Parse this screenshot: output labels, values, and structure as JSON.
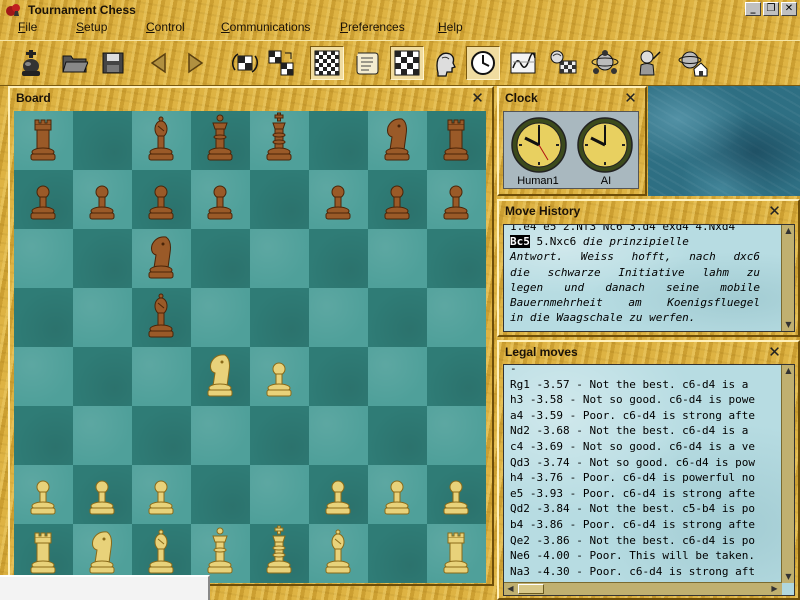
{
  "window": {
    "title": "Tournament Chess",
    "minimize": "_",
    "restore": "❐",
    "close": "✕"
  },
  "menu": [
    "File",
    "Setup",
    "Control",
    "Communications",
    "Preferences",
    "Help"
  ],
  "toolbar": [
    {
      "name": "new-game-king-icon"
    },
    {
      "name": "open-folder-icon"
    },
    {
      "name": "save-disk-icon"
    },
    {
      "name": "back-arrow-icon"
    },
    {
      "name": "forward-arrow-icon"
    },
    {
      "name": "flip-board-icon"
    },
    {
      "name": "swap-sides-icon"
    },
    {
      "name": "board-2d-icon",
      "pressed": true
    },
    {
      "name": "scroll-notation-icon"
    },
    {
      "name": "board-3d-icon",
      "pressed": true
    },
    {
      "name": "human-head-icon"
    },
    {
      "name": "clock-icon",
      "pressed": true
    },
    {
      "name": "evaluation-graph-icon"
    },
    {
      "name": "analysis-icon"
    },
    {
      "name": "network-icon"
    },
    {
      "name": "teacher-icon"
    },
    {
      "name": "home-icon"
    }
  ],
  "board_panel": {
    "title": "Board",
    "close": "✕",
    "rows": [
      [
        "br",
        "",
        "bb",
        "bq",
        "bk",
        "",
        "bn",
        "br"
      ],
      [
        "bp",
        "bp",
        "bp",
        "bp",
        "",
        "bp",
        "bp",
        "bp"
      ],
      [
        "",
        "",
        "bn",
        "",
        "",
        "",
        "",
        ""
      ],
      [
        "",
        "",
        "bb",
        "",
        "",
        "",
        "",
        ""
      ],
      [
        "",
        "",
        "",
        "wn",
        "wp",
        "",
        "",
        ""
      ],
      [
        "",
        "",
        "",
        "",
        "",
        "",
        "",
        ""
      ],
      [
        "wp",
        "wp",
        "wp",
        "",
        "",
        "wp",
        "wp",
        "wp"
      ],
      [
        "wr",
        "wn",
        "wb",
        "wq",
        "wk",
        "wb",
        "",
        "wr"
      ]
    ]
  },
  "clock_panel": {
    "title": "Clock",
    "close": "✕",
    "players": [
      "Human1",
      "AI"
    ]
  },
  "history_panel": {
    "title": "Move History",
    "close": "✕",
    "top_line": "1.e4 e5 2.Nf3 Nc6 3.d4 exd4 4.Nxd4",
    "highlight": "Bc5",
    "move": " 5.Nxc6",
    "comment": [
      "die prinzipielle",
      "Antwort. Weiss hofft, nach dxc6",
      "die schwarze Initiative lahm zu",
      "legen und danach seine mobile",
      "Bauernmehrheit am Koenigsfluegel",
      "in die Waagschale zu werfen."
    ]
  },
  "legal_panel": {
    "title": "Legal moves",
    "close": "✕",
    "lines": [
      "-",
      "Rg1 -3.57 - Not the best. c6-d4 is a",
      "h3 -3.58 - Not so good. c6-d4 is powe",
      "a4 -3.59 - Poor. c6-d4 is strong afte",
      "Nd2 -3.68 - Not the best. c6-d4 is a",
      "c4 -3.69 - Not so good. c6-d4 is a ve",
      "Qd3 -3.74 - Not so good. c6-d4 is pow",
      "h4 -3.76 - Poor. c6-d4 is powerful no",
      "e5 -3.93 - Poor. c6-d4 is strong afte",
      "Qd2 -3.84 - Not the best. c5-b4 is po",
      "b4 -3.86 - Poor. c6-d4 is strong afte",
      "Qe2 -3.86 - Not the best. c6-d4 is po",
      "Ne6 -4.00 - Poor. This will be taken.",
      "Na3 -4.30 - Poor. c6-d4 is strong aft"
    ]
  },
  "colors": {
    "light_square": "#4fa09a",
    "dark_square": "#2f7c76",
    "wood": "#d8ac3a",
    "black_piece": "#9a5a28",
    "white_piece": "#e8d27a"
  }
}
